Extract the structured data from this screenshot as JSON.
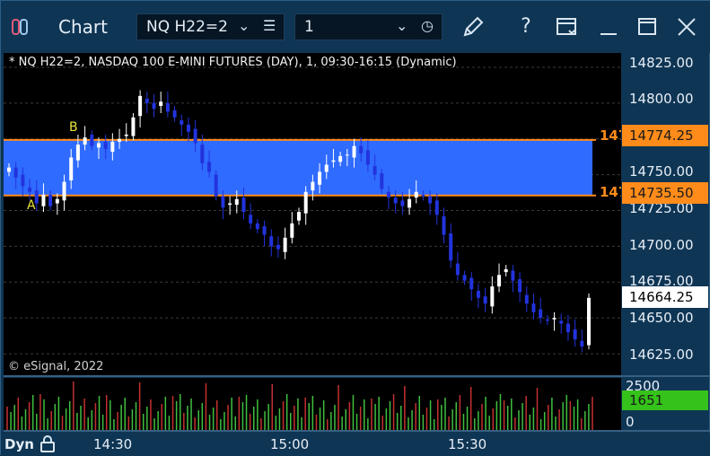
{
  "window": {
    "title": "Chart",
    "symbol_combo": "NQ H22=2",
    "interval_combo": "1"
  },
  "chart": {
    "title": "* NQ H22=2, NASDAQ 100 E-MINI FUTURES (DAY), 1, 09:30-16:15 (Dynamic)",
    "copyright": "© eSignal, 2022",
    "letter_a": "A",
    "letter_b": "B",
    "band_upper_stub": "147",
    "band_lower_stub": "147"
  },
  "price_axis": {
    "ticks": [
      "14825.00",
      "14800.00",
      "14750.00",
      "14725.00",
      "14700.00",
      "14675.00",
      "14650.00",
      "14625.00"
    ],
    "upper_tag": "14774.25",
    "lower_tag": "14735.50",
    "last_tag": "14664.25"
  },
  "volume_axis": {
    "top": "2500",
    "bottom": "0",
    "last_tag": "1651"
  },
  "time_axis": {
    "mode": "Dyn",
    "ticks": [
      "14:30",
      "15:00",
      "15:30"
    ]
  },
  "colors": {
    "band": "#2f6bff",
    "band_edge": "#ff8c1a",
    "up_candle": "#ffffff",
    "down_candle": "#2233dd",
    "vol_up": "#3fbf3f",
    "vol_down": "#c43030",
    "tag_orange": "#ff8c1a",
    "tag_green": "#35c21a"
  },
  "chart_data": {
    "type": "candlestick",
    "price_range": [
      14610,
      14835
    ],
    "band": {
      "high": 14774.25,
      "low": 14735.5
    },
    "last_price": 14664.25,
    "closes": [
      14755,
      14748,
      14742,
      14738,
      14730,
      14736,
      14728,
      14733,
      14745,
      14762,
      14771,
      14776,
      14770,
      14772,
      14768,
      14773,
      14775,
      14778,
      14790,
      14805,
      14800,
      14796,
      14801,
      14794,
      14790,
      14785,
      14780,
      14772,
      14758,
      14752,
      14735,
      14727,
      14730,
      14733,
      14724,
      14716,
      14712,
      14708,
      14700,
      14698,
      14706,
      14716,
      14724,
      14738,
      14745,
      14752,
      14757,
      14760,
      14763,
      14764,
      14770,
      14765,
      14757,
      14750,
      14740,
      14734,
      14730,
      14728,
      14733,
      14738,
      14735,
      14730,
      14722,
      14708,
      14690,
      14680,
      14676,
      14670,
      14664,
      14660,
      14672,
      14680,
      14684,
      14676,
      14668,
      14660,
      14654,
      14650,
      14648,
      14650,
      14646,
      14640,
      14635,
      14630,
      14664
    ],
    "volume": {
      "max": 2500,
      "last": 1651
    }
  }
}
